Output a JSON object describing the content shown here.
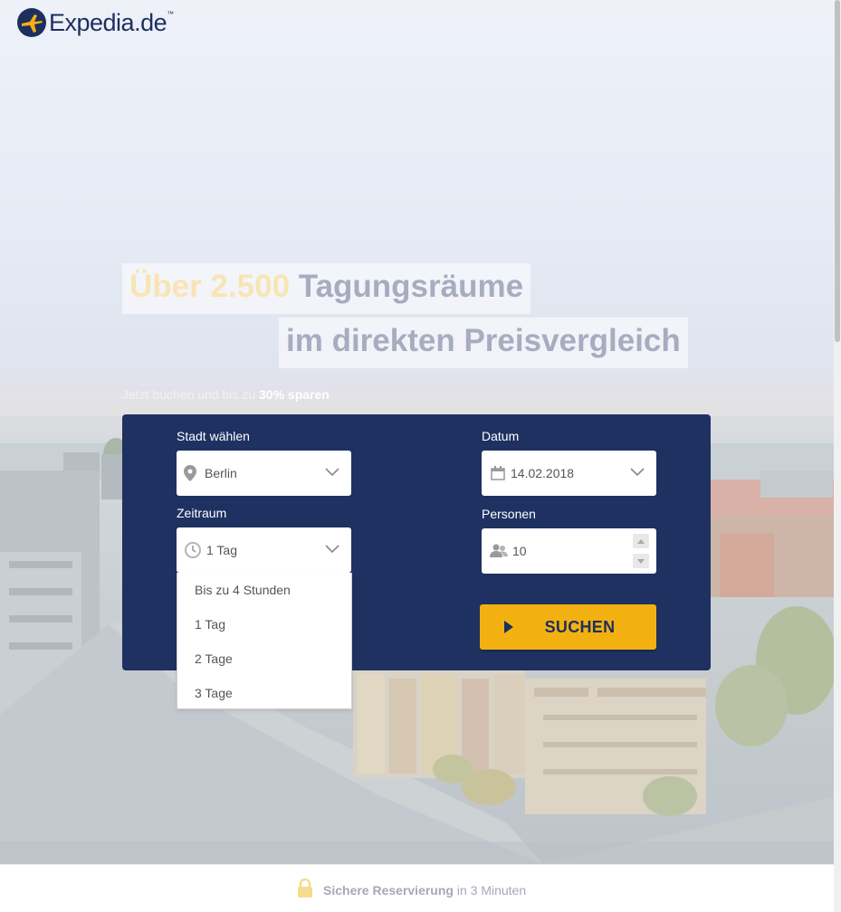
{
  "brand": {
    "name": "Expedia.de",
    "tm": "™"
  },
  "hero": {
    "headline_highlight": "Über 2.500",
    "headline_rest": "Tagungsräume",
    "headline_line2": "im direkten Preisvergleich",
    "subline_text": "Jetzt buchen und bis zu",
    "subline_bold": "30% sparen"
  },
  "form": {
    "city_label": "Stadt wählen",
    "city_value": "Berlin",
    "date_label": "Datum",
    "date_value": "14.02.2018",
    "period_label": "Zeitraum",
    "period_value": "1 Tag",
    "persons_label": "Personen",
    "persons_value": "10",
    "search_label": "SUCHEN"
  },
  "period_options": [
    "Bis zu 4 Stunden",
    "1 Tag",
    "2 Tage",
    "3 Tage"
  ],
  "footer": {
    "bold": "Sichere Reservierung",
    "rest": "in 3 Minuten"
  },
  "colors": {
    "panel": "#1e3161",
    "accent": "#f3b111",
    "brand": "#1d2f5e"
  }
}
